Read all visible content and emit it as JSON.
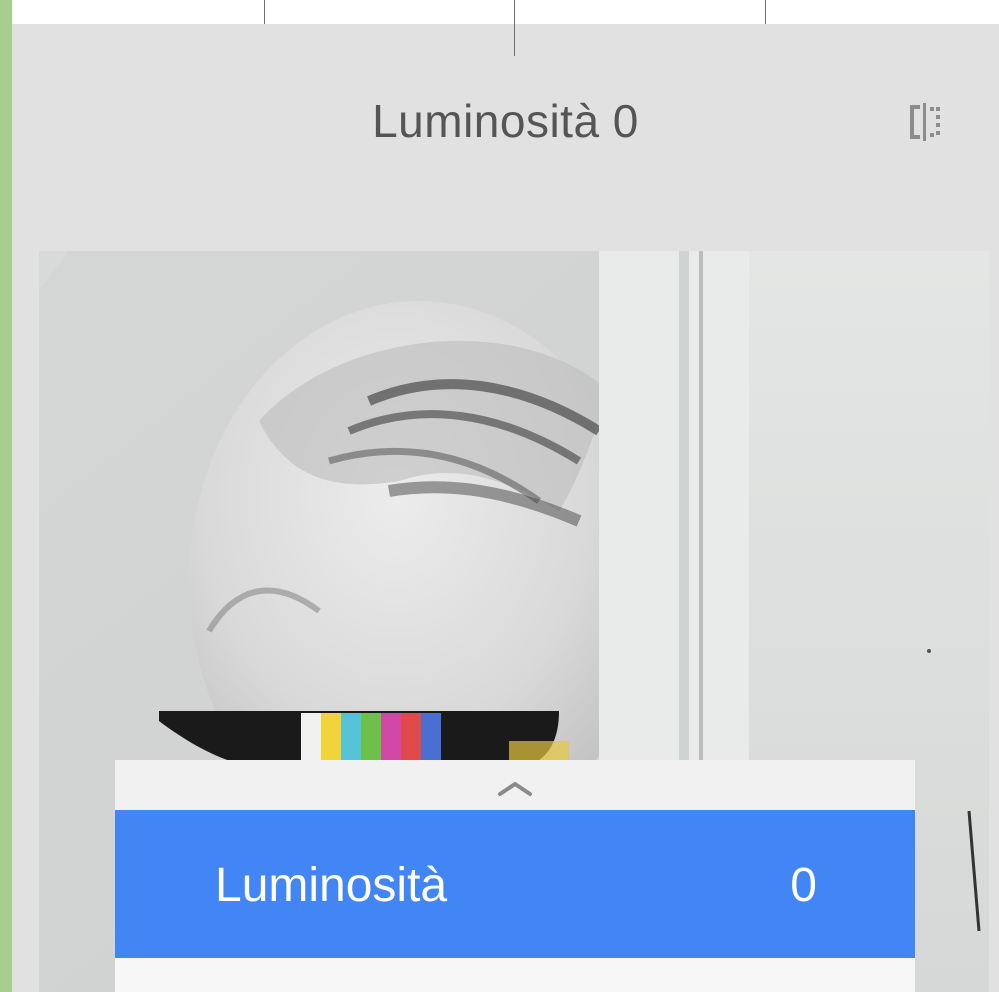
{
  "header": {
    "title": "Luminosità 0",
    "compare_icon": "compare-split-icon"
  },
  "photo": {
    "subject": "poster-face-rainbow-glasses"
  },
  "adjust_panel": {
    "collapse_icon": "chevron-up-icon",
    "selected": {
      "label": "Luminosità",
      "value": "0"
    }
  },
  "colors": {
    "accent": "#4285f4",
    "frame": "#a7cc8f",
    "header_bg": "#e1e1e1",
    "title_text": "#555555"
  }
}
